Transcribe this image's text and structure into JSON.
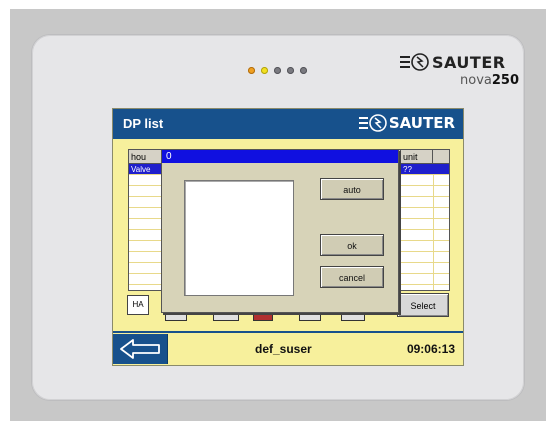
{
  "device": {
    "brand": "SAUTER",
    "model_prefix": "nova",
    "model_number": "250",
    "status_leds": [
      "orange",
      "yellow",
      "gray",
      "gray",
      "gray"
    ]
  },
  "screen": {
    "title": "DP list",
    "logo_text": "SAUTER",
    "table": {
      "header_left": "hou",
      "header_right": "unit",
      "selected_row_left": "Valve",
      "selected_row_right": "??"
    },
    "dialog": {
      "value": "0",
      "auto_label": "auto",
      "ok_label": "ok",
      "cancel_label": "cancel"
    },
    "ha_label": "HA",
    "select_label": "Select",
    "status": {
      "user": "def_suser",
      "time": "09:06:13"
    }
  },
  "colors": {
    "title_bar": "#17518c",
    "screen_background": "#f7f09c",
    "dialog_title": "#1010e0",
    "selection": "#1f1fcc"
  }
}
